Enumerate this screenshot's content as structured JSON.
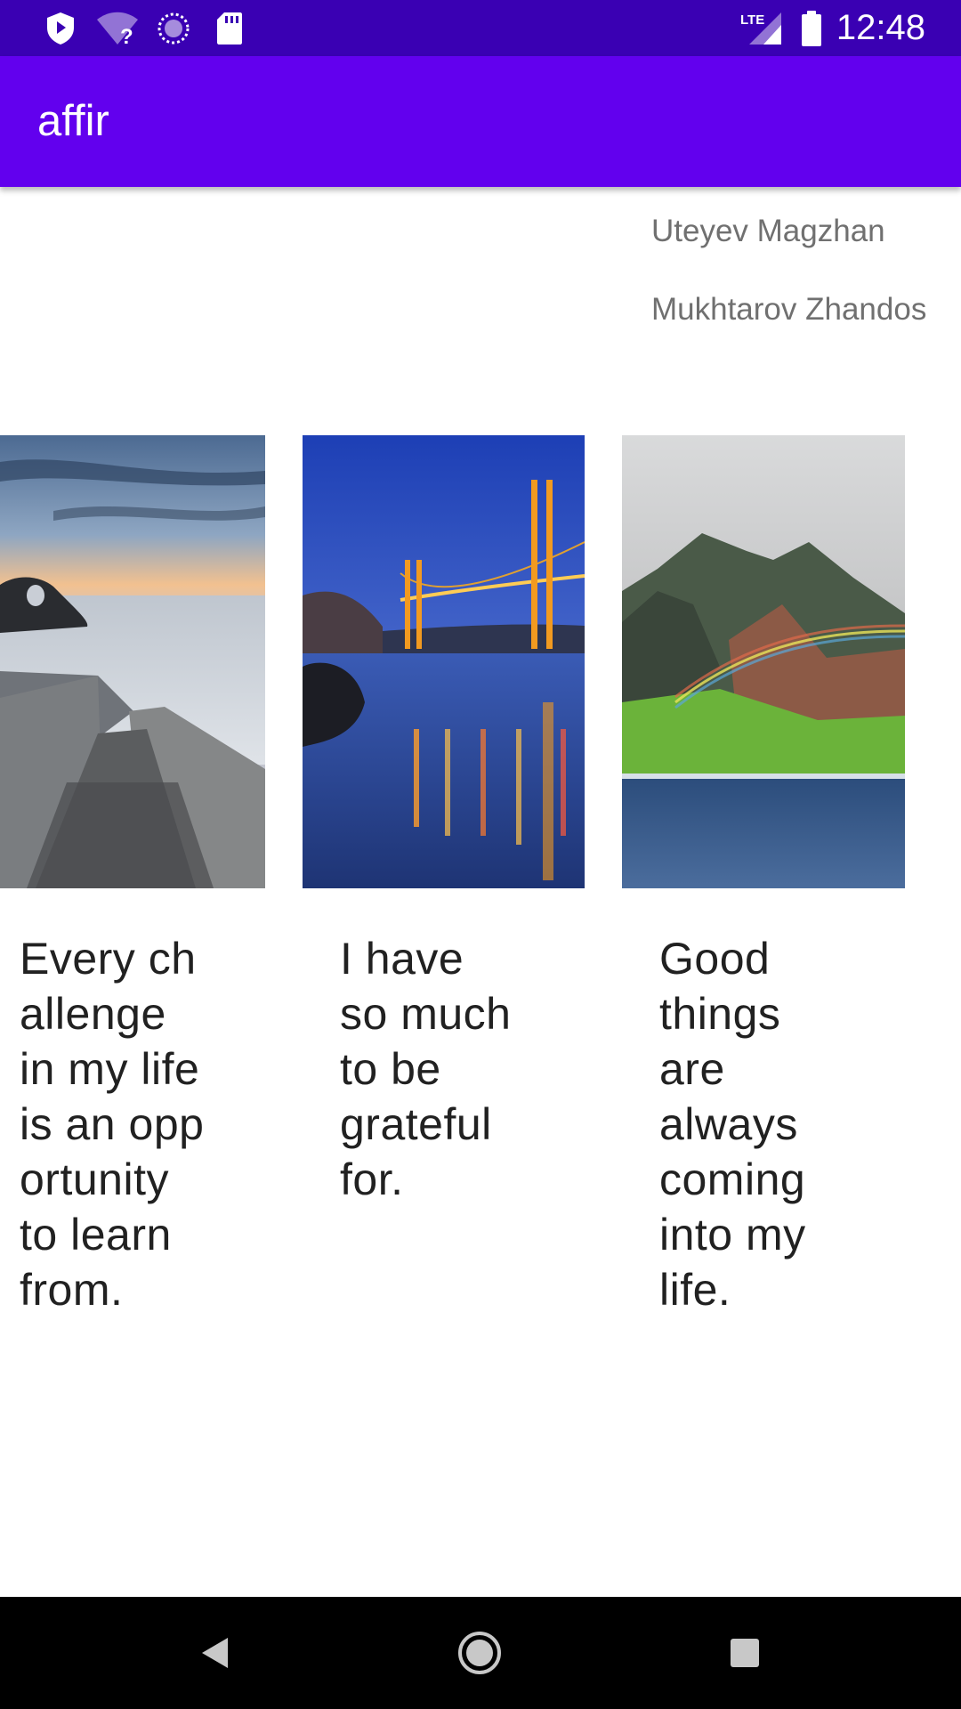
{
  "status_bar": {
    "time": "12:48",
    "network_label": "LTE",
    "icons": [
      "shield-icon",
      "wifi-unknown-icon",
      "sync-icon",
      "sd-card-icon",
      "lte-signal-icon",
      "battery-icon"
    ]
  },
  "app_bar": {
    "title": "affir"
  },
  "authors": [
    "Uteyev Magzhan",
    "Mukhtarov Zhandos"
  ],
  "cards": [
    {
      "image": "seashore-pier-photo",
      "text": "Every ch\nallenge\nin my life\nis an opp\nortunity\nto learn\nfrom."
    },
    {
      "image": "golden-gate-bridge-photo",
      "text": "I have\nso much\nto be\ngrateful\nfor."
    },
    {
      "image": "mountain-rainbow-photo",
      "text": "Good\nthings\nare\nalways\ncoming\ninto my\nlife."
    }
  ],
  "nav_bar": {
    "icons": [
      "back-icon",
      "home-icon",
      "recents-icon"
    ]
  },
  "colors": {
    "status_bar": "#3a00b3",
    "app_bar": "#6200ee",
    "author_text": "#707070",
    "card_text": "#212121"
  }
}
